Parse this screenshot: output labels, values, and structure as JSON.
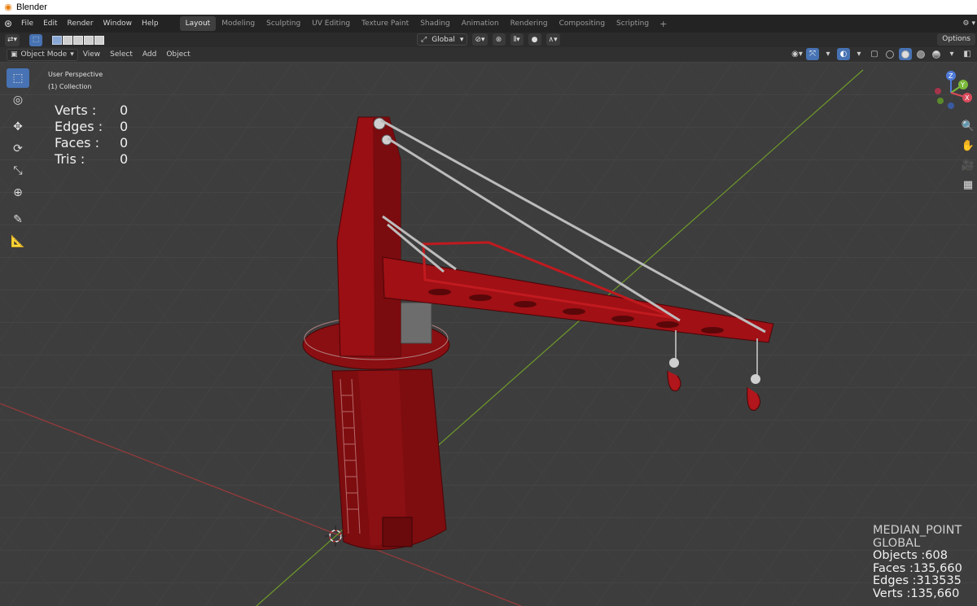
{
  "window": {
    "title": "Blender"
  },
  "menu": {
    "items": [
      "File",
      "Edit",
      "Render",
      "Window",
      "Help"
    ]
  },
  "workspaces": {
    "tabs": [
      "Layout",
      "Modeling",
      "Sculpting",
      "UV Editing",
      "Texture Paint",
      "Shading",
      "Animation",
      "Rendering",
      "Compositing",
      "Scripting"
    ],
    "active": "Layout",
    "add_symbol": "+"
  },
  "tool_settings": {
    "orientation": "Global",
    "options_label": "Options"
  },
  "viewport_header": {
    "mode": "Object Mode",
    "menus": [
      "View",
      "Select",
      "Add",
      "Object"
    ]
  },
  "viewport": {
    "perspective_label": "User Perspective",
    "collection_label": "(1) Collection"
  },
  "edit_stats": {
    "verts_label": "Verts :",
    "verts_value": "0",
    "edges_label": "Edges :",
    "edges_value": "0",
    "faces_label": "Faces :",
    "faces_value": "0",
    "tris_label": "Tris :",
    "tris_value": "0"
  },
  "scene_stats": {
    "pivot": "MEDIAN_POINT",
    "orientation": "GLOBAL",
    "objects": "Objects :608",
    "faces": "Faces :135,660",
    "edges": "Edges :313535",
    "verts": "Verts :135,660"
  },
  "gizmo": {
    "z_label": "Z",
    "y_label": "Y",
    "x_label": "X"
  },
  "colors": {
    "accent_blue": "#4772b3",
    "crane_red": "#8b0f12",
    "axis_x": "#9b3a3a",
    "axis_y": "#6f9a2a"
  }
}
